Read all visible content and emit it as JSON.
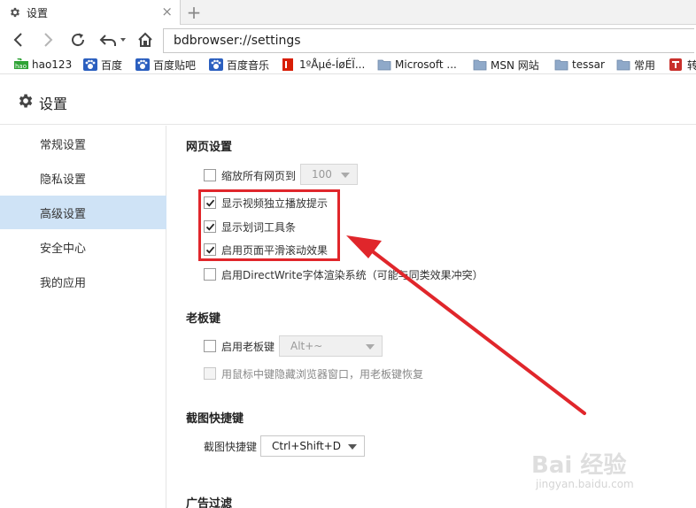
{
  "tab": {
    "title": "设置",
    "close": "×",
    "new_tab": "+"
  },
  "address_bar": {
    "url": "bdbrowser://settings"
  },
  "bookmarks": [
    {
      "label": "hao123",
      "icon": "hao123-icon"
    },
    {
      "label": "百度",
      "icon": "baidu-paw-icon"
    },
    {
      "label": "百度贴吧",
      "icon": "baidu-paw-icon"
    },
    {
      "label": "百度音乐",
      "icon": "baidu-paw-icon"
    },
    {
      "label": "1ºÅµé-ÍøÉÏ...",
      "icon": "red-flag-icon"
    },
    {
      "label": "Microsoft ...",
      "icon": "folder-icon"
    },
    {
      "label": "MSN 网站",
      "icon": "folder-icon"
    },
    {
      "label": "tessar",
      "icon": "folder-icon"
    },
    {
      "label": "常用",
      "icon": "folder-icon"
    },
    {
      "label": "转",
      "icon": "red-app-icon"
    }
  ],
  "page": {
    "title": "设置"
  },
  "sidebar": {
    "items": [
      {
        "label": "常规设置",
        "active": false
      },
      {
        "label": "隐私设置",
        "active": false
      },
      {
        "label": "高级设置",
        "active": true
      },
      {
        "label": "安全中心",
        "active": false
      },
      {
        "label": "我的应用",
        "active": false
      }
    ]
  },
  "webpage_settings": {
    "title": "网页设置",
    "zoom_label": "缩放所有网页到",
    "zoom_value": "100",
    "zoom_checked": false,
    "options": [
      {
        "label": "显示视频独立播放提示",
        "checked": true
      },
      {
        "label": "显示划词工具条",
        "checked": true
      },
      {
        "label": "启用页面平滑滚动效果",
        "checked": true
      },
      {
        "label": "启用DirectWrite字体渲染系统（可能与同类效果冲突）",
        "checked": false
      }
    ]
  },
  "boss_key": {
    "title": "老板键",
    "enable_label": "启用老板键",
    "enable_checked": false,
    "key_value": "Alt+~",
    "middle_click_label": "用鼠标中键隐藏浏览器窗口，用老板键恢复",
    "middle_click_checked": false
  },
  "screenshot": {
    "title": "截图快捷键",
    "label": "截图快捷键",
    "value": "Ctrl+Shift+D"
  },
  "ad_filter": {
    "title": "广告过滤"
  },
  "watermark": {
    "main": "Bai 经验",
    "sub": "jingyan.baidu.com"
  },
  "colors": {
    "highlight": "#e0262b",
    "active_sidebar": "#cfe3f6",
    "arrow": "#e0262b"
  }
}
